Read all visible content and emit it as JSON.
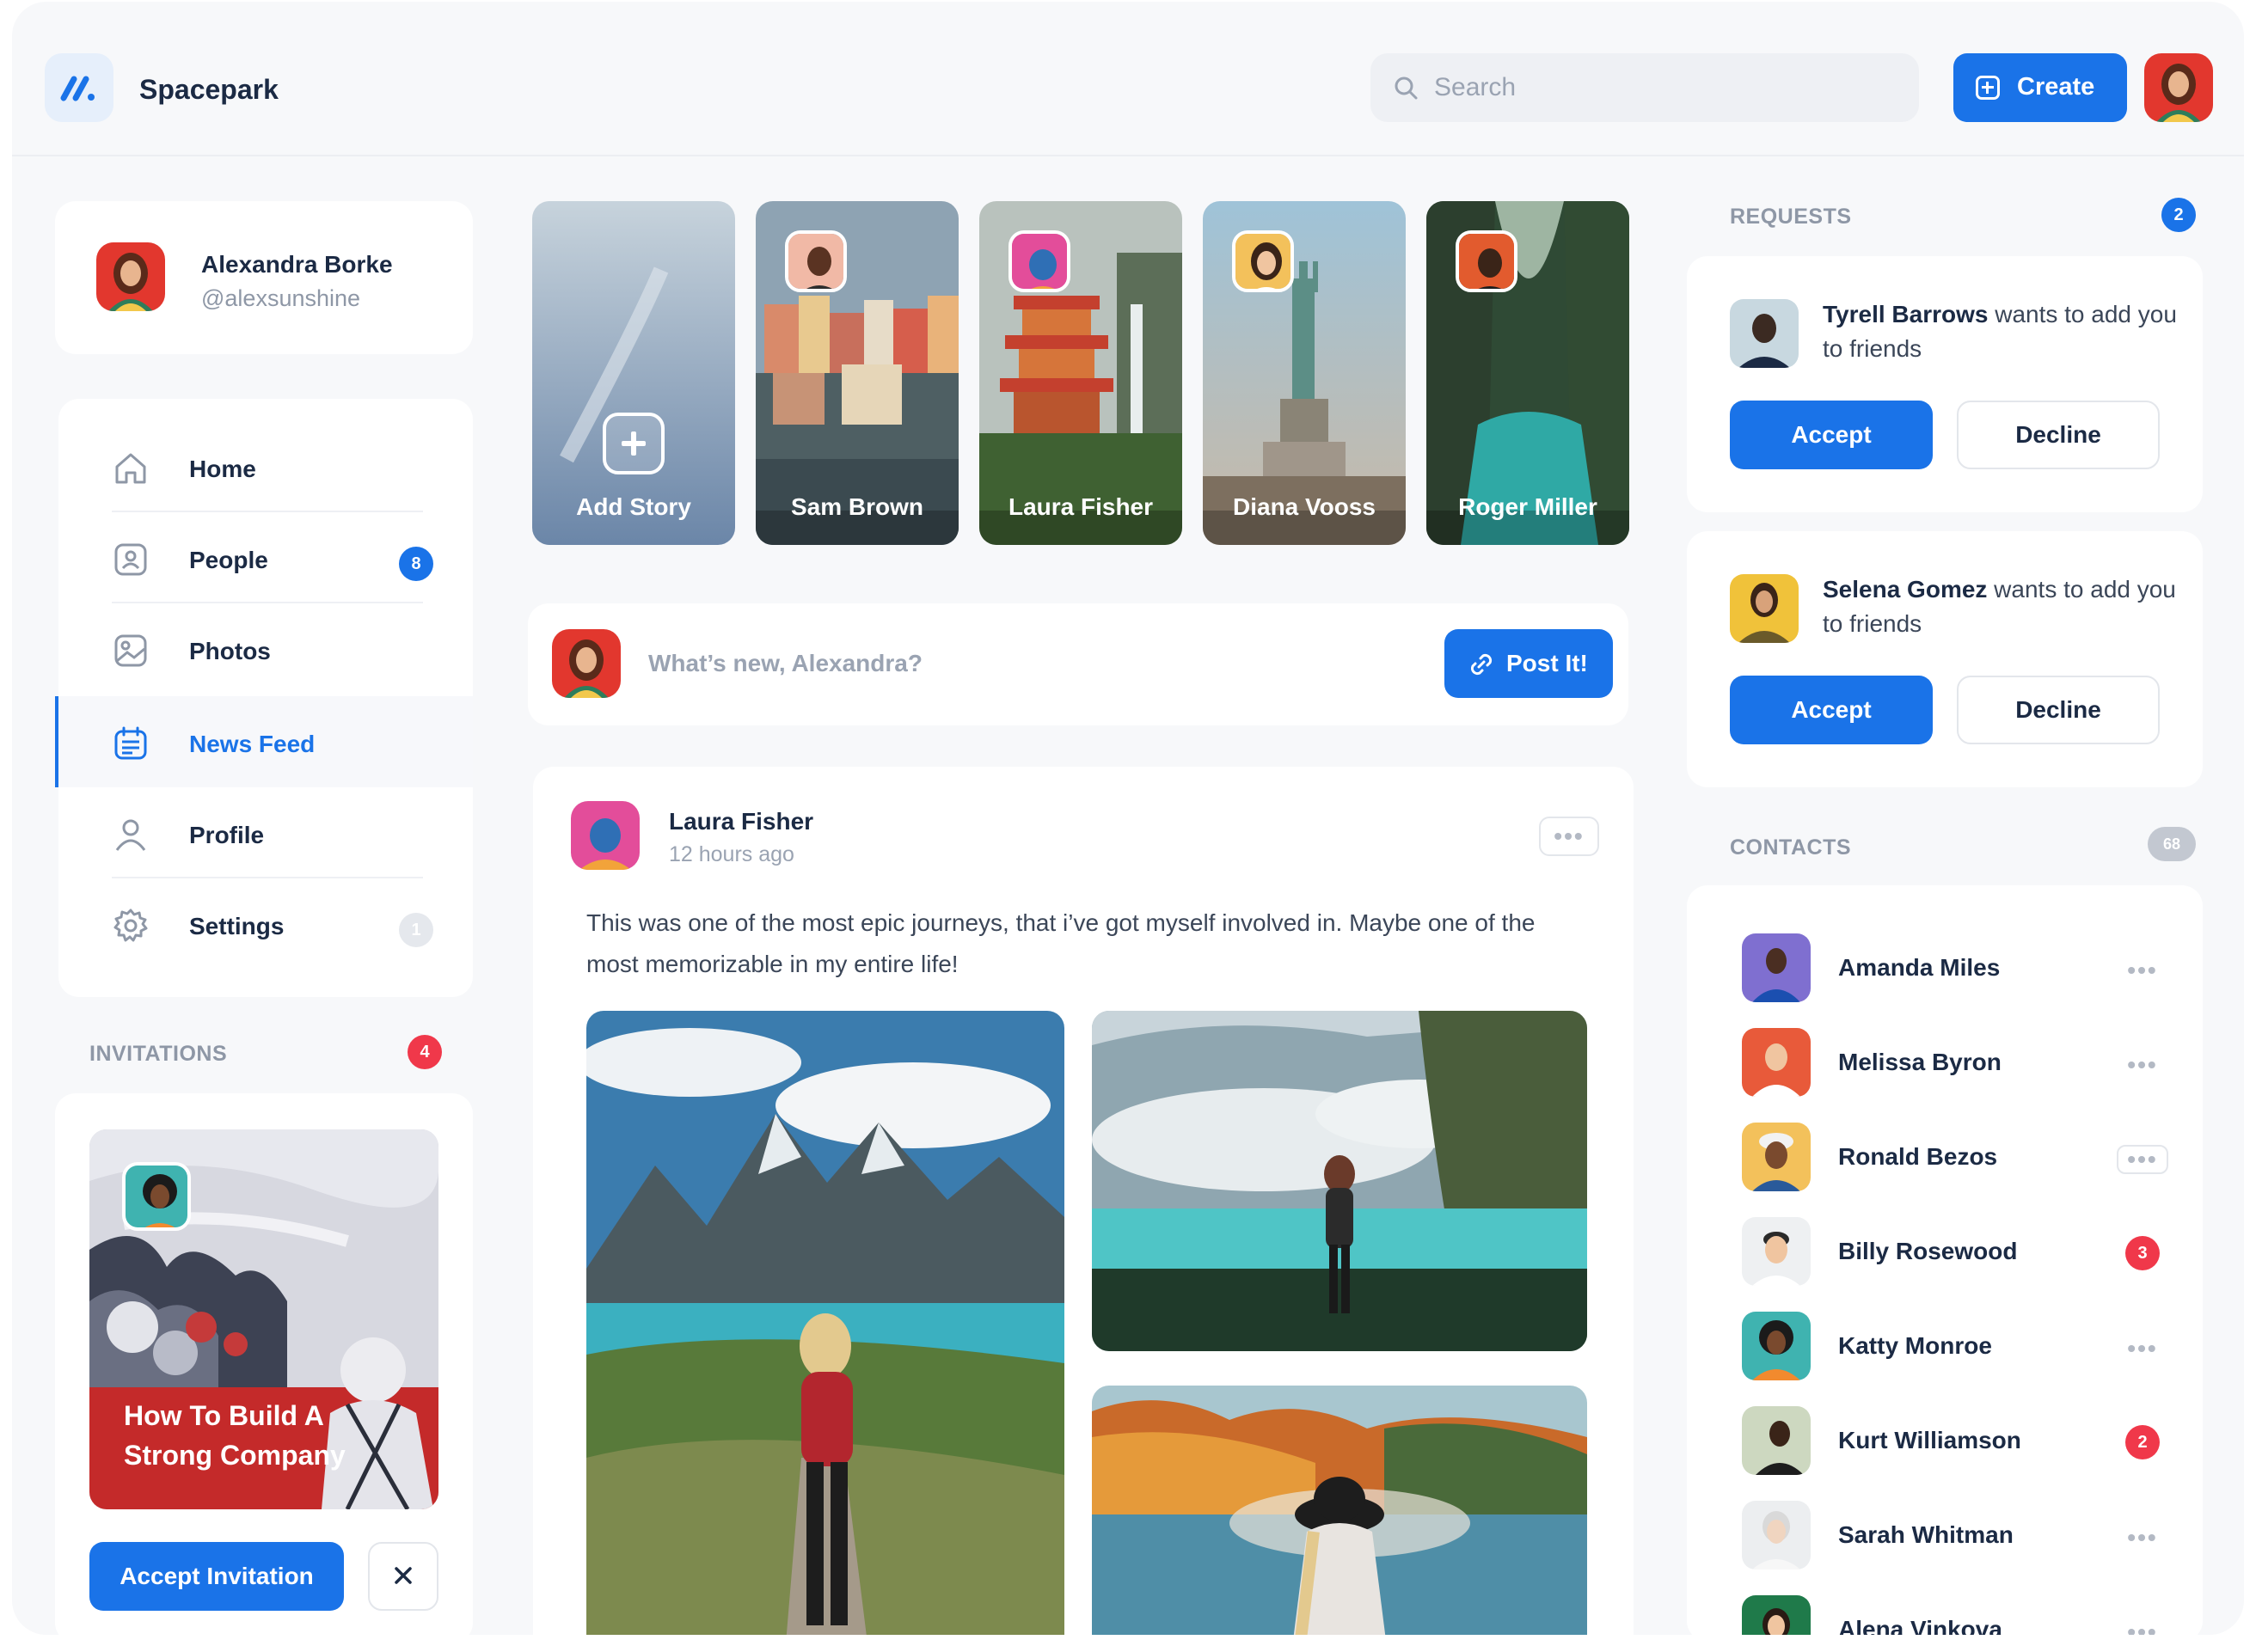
{
  "app": {
    "name": "Spacepark"
  },
  "colors": {
    "accent": "#1a73e8",
    "danger": "#f0384a",
    "muted": "#c3c8d1"
  },
  "header": {
    "search_placeholder": "Search",
    "create_label": "Create"
  },
  "profile": {
    "name": "Alexandra Borke",
    "handle": "@alexsunshine"
  },
  "nav": {
    "items": [
      {
        "label": "Home",
        "icon": "home-icon"
      },
      {
        "label": "People",
        "icon": "people-icon",
        "badge": "8"
      },
      {
        "label": "Photos",
        "icon": "photos-icon"
      },
      {
        "label": "News Feed",
        "icon": "calendar-icon",
        "active": true
      },
      {
        "label": "Profile",
        "icon": "user-icon"
      },
      {
        "label": "Settings",
        "icon": "gear-icon",
        "badge": "1"
      }
    ]
  },
  "invitations": {
    "title": "INVITATIONS",
    "count": "4",
    "card_title": "How To Build A Strong Company",
    "accept_label": "Accept Invitation",
    "close_icon": "close-icon"
  },
  "stories": [
    {
      "name": "Add Story",
      "add": true
    },
    {
      "name": "Sam Brown"
    },
    {
      "name": "Laura Fisher"
    },
    {
      "name": "Diana Vooss"
    },
    {
      "name": "Roger Miller"
    }
  ],
  "composer": {
    "placeholder": "What’s new, Alexandra?",
    "post_label": "Post It!"
  },
  "post": {
    "author": "Laura Fisher",
    "time": "12 hours ago",
    "text": "This was one of the most epic journeys, that i’ve got myself involved in. Maybe one of the most memorizable in my entire life!",
    "more": "•••"
  },
  "requests": {
    "title": "REQUESTS",
    "count": "2",
    "items": [
      {
        "name": "Tyrell Barrows",
        "message": " wants to add you to friends"
      },
      {
        "name": "Selena Gomez",
        "message": " wants to add you to friends"
      }
    ],
    "accept_label": "Accept",
    "decline_label": "Decline"
  },
  "contacts": {
    "title": "CONTACTS",
    "count": "68",
    "more": "•••",
    "items": [
      {
        "name": "Amanda Miles"
      },
      {
        "name": "Melissa Byron"
      },
      {
        "name": "Ronald Bezos"
      },
      {
        "name": "Billy Rosewood",
        "badge": "3"
      },
      {
        "name": "Katty Monroe"
      },
      {
        "name": "Kurt Williamson",
        "badge": "2"
      },
      {
        "name": "Sarah Whitman"
      },
      {
        "name": "Alena Vinkova"
      }
    ]
  }
}
